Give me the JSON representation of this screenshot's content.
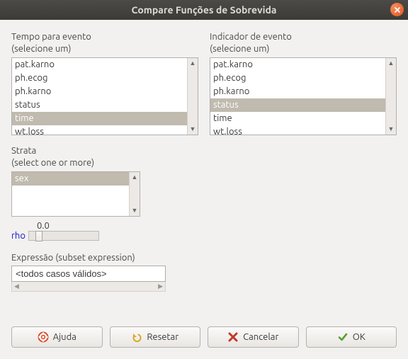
{
  "window": {
    "title": "Compare Funções de Sobrevida"
  },
  "time_group": {
    "label_line1": "Tempo para evento",
    "label_line2": "(selecione um)",
    "items": [
      "pat.karno",
      "ph.ecog",
      "ph.karno",
      "status",
      "time",
      "wt.loss"
    ],
    "selected": "time"
  },
  "indicator_group": {
    "label_line1": "Indicador de evento",
    "label_line2": "(selecione um)",
    "items": [
      "pat.karno",
      "ph.ecog",
      "ph.karno",
      "status",
      "time",
      "wt.loss"
    ],
    "selected": "status"
  },
  "strata_group": {
    "label_line1": "Strata",
    "label_line2": "(select one or more)",
    "items": [
      "sex"
    ],
    "selected": "sex"
  },
  "rho": {
    "label": "rho",
    "value": "0.0"
  },
  "expression": {
    "label": "Expressão (subset expression)",
    "value": "<todos casos válidos>"
  },
  "buttons": {
    "help": "Ajuda",
    "reset": "Resetar",
    "cancel": "Cancelar",
    "ok": "OK"
  }
}
